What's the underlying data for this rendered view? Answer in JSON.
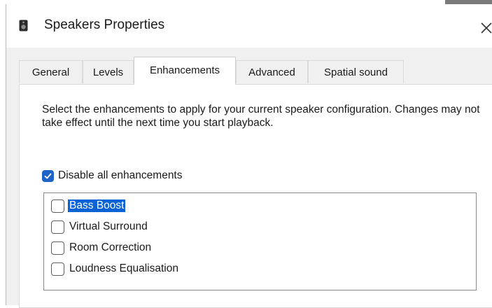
{
  "window": {
    "title": "Speakers Properties"
  },
  "tabs": [
    {
      "label": "General"
    },
    {
      "label": "Levels"
    },
    {
      "label": "Enhancements",
      "active": true
    },
    {
      "label": "Advanced"
    },
    {
      "label": "Spatial sound"
    }
  ],
  "enhancements": {
    "description": "Select the enhancements to apply for your current speaker configuration. Changes may not take effect until the next time you start playback.",
    "disable_all_label": "Disable all enhancements",
    "disable_all_checked": true,
    "items": [
      {
        "label": "Bass Boost",
        "checked": false,
        "selected": true
      },
      {
        "label": "Virtual Surround",
        "checked": false,
        "selected": false
      },
      {
        "label": "Room Correction",
        "checked": false,
        "selected": false
      },
      {
        "label": "Loudness Equalisation",
        "checked": false,
        "selected": false
      }
    ]
  },
  "icons": {
    "title_icon": "speaker-icon",
    "close_icon": "close-icon",
    "check_icon": "checkmark-icon"
  },
  "colors": {
    "accent": "#1e64c8",
    "selection": "#0a63d6"
  }
}
